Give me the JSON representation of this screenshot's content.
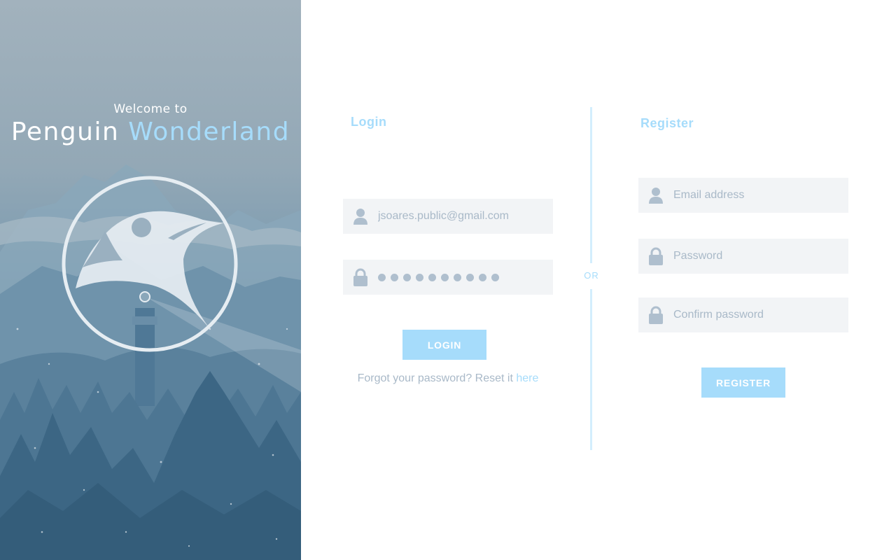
{
  "hero": {
    "welcome": "Welcome to",
    "brand_part1": "Penguin",
    "brand_part2": "Wonderland"
  },
  "login": {
    "title": "Login",
    "email_value": "jsoares.public@gmail.com",
    "password_masked_count": 10,
    "button_label": "LOGIN",
    "forgot_text": "Forgot your password? Reset it ",
    "forgot_link": "here"
  },
  "divider": {
    "label": "OR"
  },
  "register": {
    "title": "Register",
    "email_placeholder": "Email address",
    "password_placeholder": "Password",
    "confirm_placeholder": "Confirm password",
    "button_label": "REGISTER"
  },
  "colors": {
    "accent": "#a6dcfb",
    "field_bg": "#f2f4f6",
    "muted_text": "#a9b9c8"
  },
  "icons": {
    "user": "user-icon",
    "lock": "lock-icon",
    "logo": "penguin-logo-icon"
  }
}
